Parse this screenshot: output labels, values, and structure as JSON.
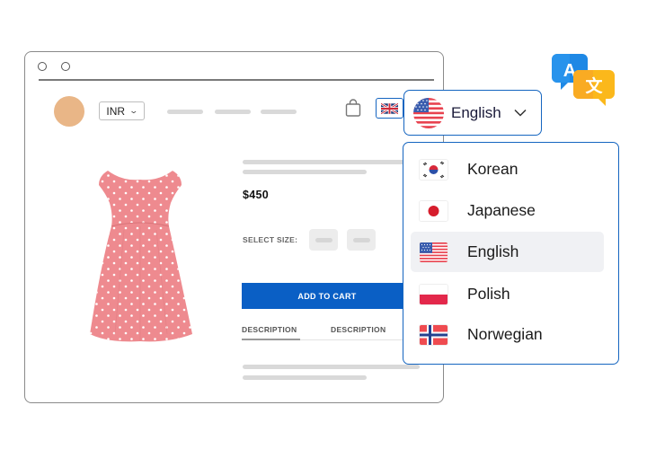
{
  "window": {
    "controls": [
      "close",
      "minimize"
    ]
  },
  "header": {
    "currency": "INR",
    "currency_chevron": "chevron-down-icon",
    "cart_icon": "shopping-bag-icon",
    "current_flag": "uk-flag-icon"
  },
  "product": {
    "image": "pink-polka-dot-dress",
    "price": "$450",
    "select_size_label": "SELECT SIZE:",
    "add_to_cart_label": "ADD TO CART",
    "tabs": [
      {
        "label": "DESCRIPTION",
        "active": true
      },
      {
        "label": "DESCRIPTION",
        "active": false
      }
    ]
  },
  "language_selector": {
    "selected_label": "English",
    "selected_flag": "us-flag-icon",
    "options": [
      {
        "label": "Korean",
        "flag": "korea-flag-icon",
        "selected": false
      },
      {
        "label": "Japanese",
        "flag": "japan-flag-icon",
        "selected": false
      },
      {
        "label": "English",
        "flag": "us-flag-icon",
        "selected": true
      },
      {
        "label": "Polish",
        "flag": "poland-flag-icon",
        "selected": false
      },
      {
        "label": "Norwegian",
        "flag": "norway-flag-icon",
        "selected": false
      }
    ]
  },
  "translate_icon": {
    "left_glyph": "A",
    "right_glyph": "文"
  },
  "colors": {
    "accent": "#0a5fc5",
    "border_accent": "#1565c0",
    "avatar": "#e9b687",
    "dress": "#ee8a8f",
    "selected_bg": "#f0f1f4"
  }
}
